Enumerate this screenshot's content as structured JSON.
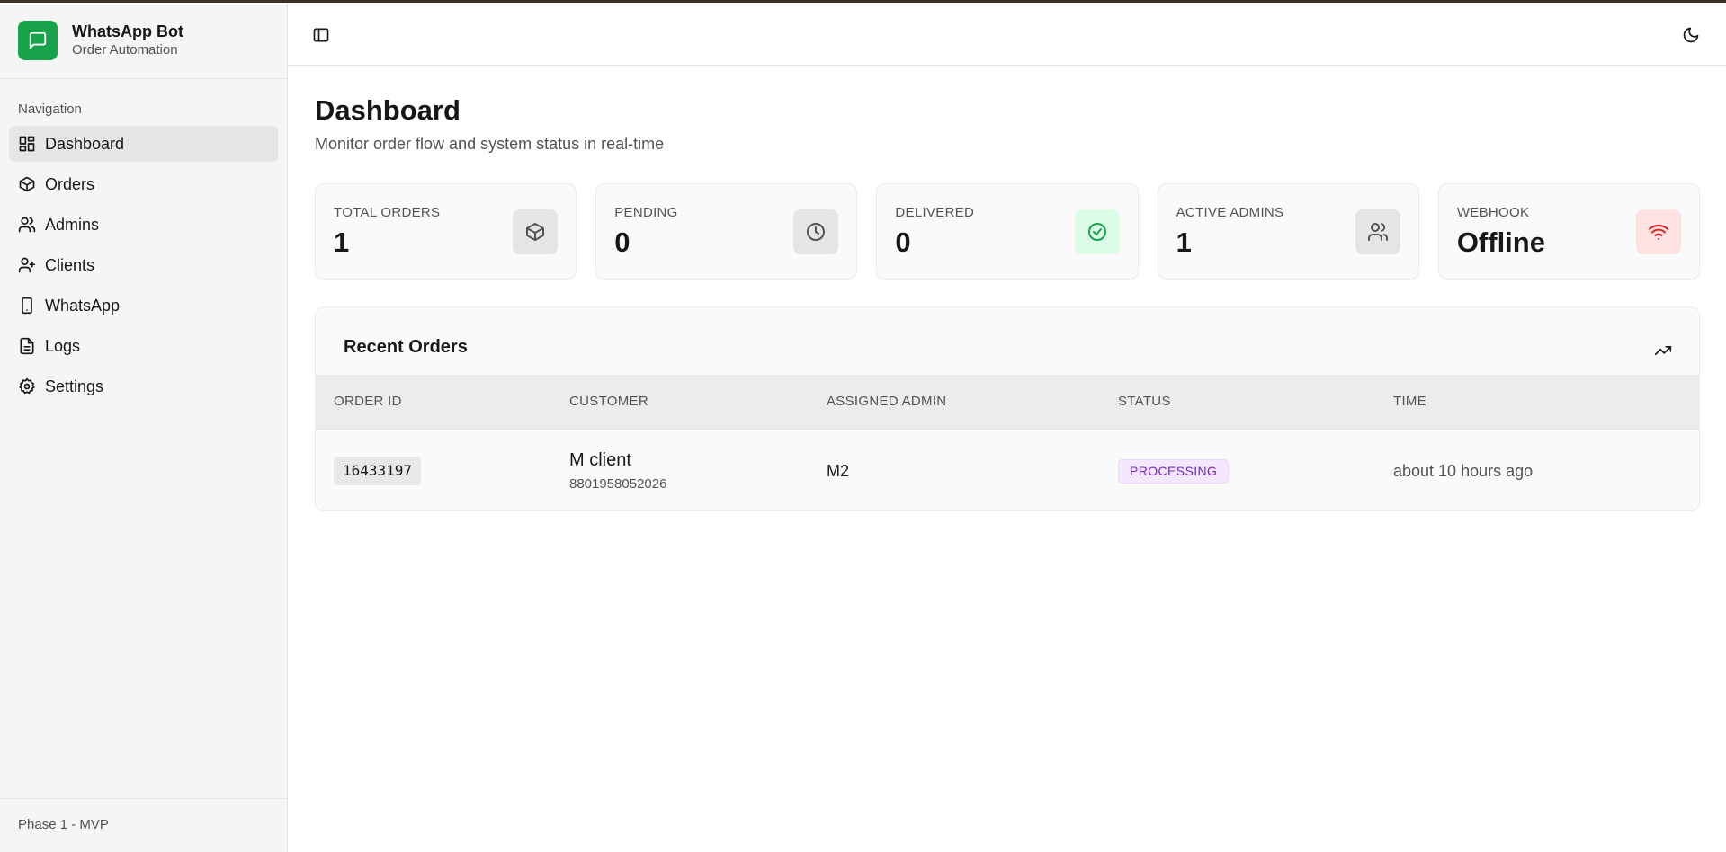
{
  "brand": {
    "title": "WhatsApp Bot",
    "subtitle": "Order Automation",
    "color": "#16a34a"
  },
  "sidebar": {
    "section_label": "Navigation",
    "items": [
      {
        "label": "Dashboard",
        "icon": "dashboard-icon",
        "active": true
      },
      {
        "label": "Orders",
        "icon": "package-icon"
      },
      {
        "label": "Admins",
        "icon": "users-icon"
      },
      {
        "label": "Clients",
        "icon": "user-plus-icon"
      },
      {
        "label": "WhatsApp",
        "icon": "phone-icon"
      },
      {
        "label": "Logs",
        "icon": "file-text-icon"
      },
      {
        "label": "Settings",
        "icon": "gear-icon"
      }
    ],
    "footer": "Phase 1 - MVP"
  },
  "header": {
    "left_icon": "sidebar-toggle-icon",
    "right_icon": "moon-icon"
  },
  "page": {
    "title": "Dashboard",
    "subtitle": "Monitor order flow and system status in real-time"
  },
  "stats": [
    {
      "label": "TOTAL ORDERS",
      "value": "1",
      "icon": "package-icon"
    },
    {
      "label": "PENDING",
      "value": "0",
      "icon": "clock-icon"
    },
    {
      "label": "DELIVERED",
      "value": "0",
      "icon": "check-circle-icon",
      "color": "#16a34a"
    },
    {
      "label": "ACTIVE ADMINS",
      "value": "1",
      "icon": "users-icon"
    },
    {
      "label": "WEBHOOK",
      "value": "Offline",
      "icon": "wifi-icon",
      "color": "#dc2626"
    }
  ],
  "recent_orders": {
    "title": "Recent Orders",
    "icon": "trending-up-icon",
    "columns": [
      "ORDER ID",
      "CUSTOMER",
      "ASSIGNED ADMIN",
      "STATUS",
      "TIME"
    ],
    "rows": [
      {
        "order_id": "16433197",
        "customer_name": "M client",
        "customer_phone": "8801958052026",
        "admin": "M2",
        "status": "PROCESSING",
        "status_color": "#7e22ce",
        "time": "about 10 hours ago"
      }
    ]
  }
}
